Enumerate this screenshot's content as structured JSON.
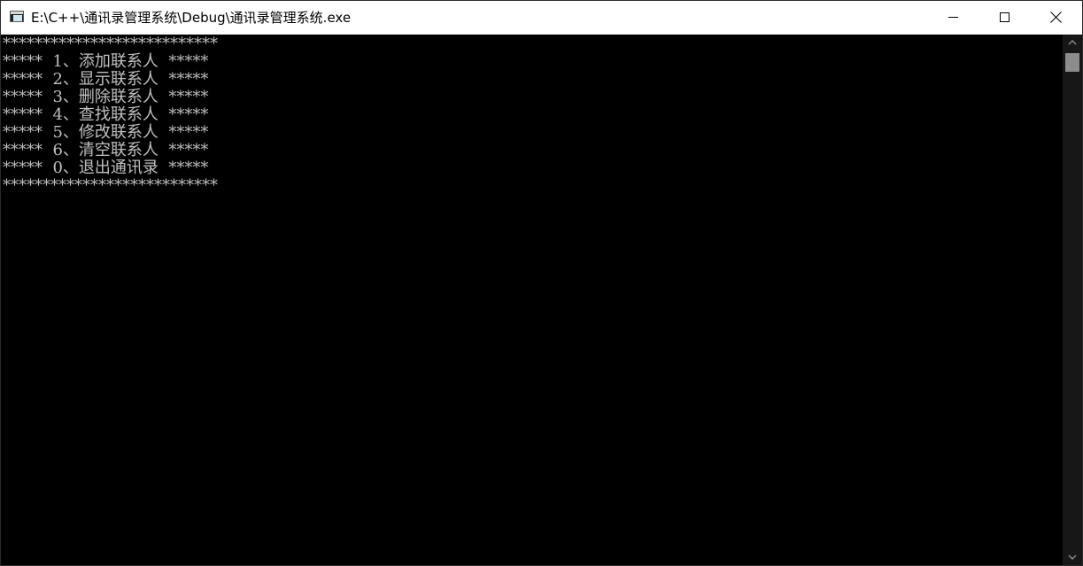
{
  "window": {
    "title": "E:\\C++\\通讯录管理系统\\Debug\\通讯录管理系统.exe",
    "controls": {
      "minimize": "minimize",
      "maximize": "maximize",
      "close": "close"
    }
  },
  "console": {
    "text_color": "#c0c0c0",
    "background": "#000000",
    "lines": [
      "***************************",
      "*****  1、添加联系人  *****",
      "*****  2、显示联系人  *****",
      "*****  3、删除联系人  *****",
      "*****  4、查找联系人  *****",
      "*****  5、修改联系人  *****",
      "*****  6、清空联系人  *****",
      "*****  0、退出通讯录  *****",
      "***************************"
    ]
  },
  "scrollbar": {
    "position": 0
  }
}
